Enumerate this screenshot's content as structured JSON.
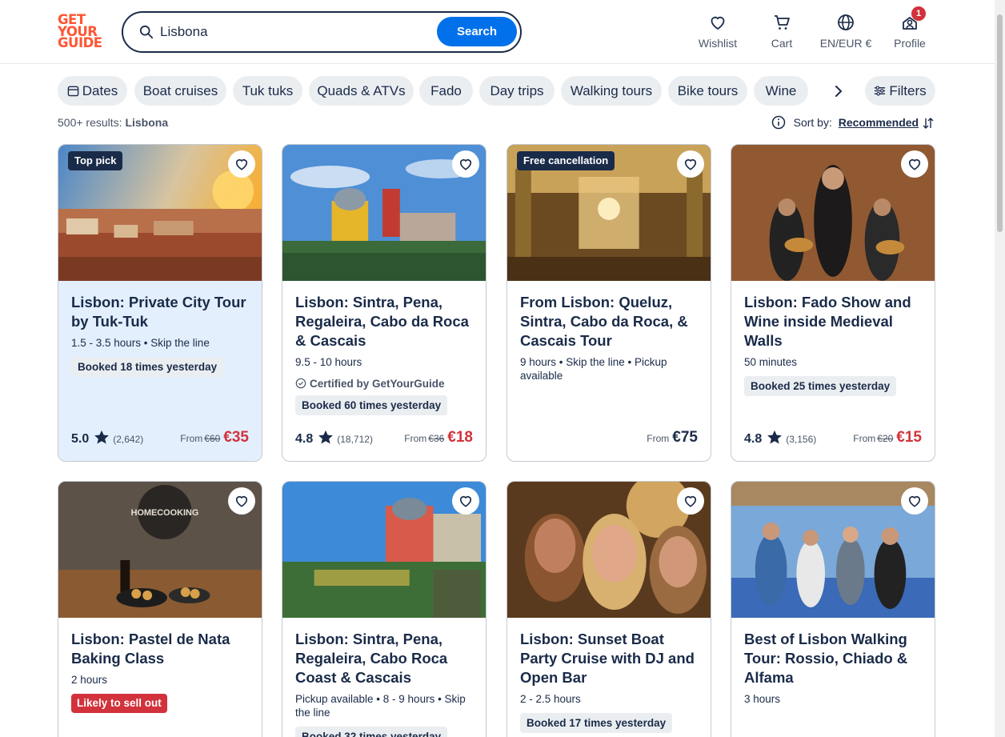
{
  "header": {
    "logo": [
      "GET",
      "YOUR",
      "GUIDE"
    ],
    "search_value": "Lisbona",
    "search_button": "Search",
    "nav": [
      {
        "label": "Wishlist",
        "icon": "heart-icon"
      },
      {
        "label": "Cart",
        "icon": "cart-icon"
      },
      {
        "label": "EN/EUR €",
        "icon": "globe-icon"
      },
      {
        "label": "Profile",
        "icon": "profile-icon",
        "badge": "1"
      }
    ]
  },
  "filters": {
    "chips": [
      "Dates",
      "Boat cruises",
      "Tuk tuks",
      "Quads & ATVs",
      "Fado",
      "Day trips",
      "Walking tours",
      "Bike tours",
      "Wine"
    ],
    "filters_label": "Filters"
  },
  "results": {
    "count": "500+ results:",
    "query": "Lisbona",
    "sort_label": "Sort by:",
    "sort_value": "Recommended"
  },
  "cards": [
    {
      "tag": "Top pick",
      "title": "Lisbon: Private City Tour by Tuk-Tuk",
      "meta": "1.5 - 3.5 hours • Skip the line",
      "booked": "Booked 18 times yesterday",
      "rating": "5.0",
      "reviews": "(2,642)",
      "from": "From",
      "old_price": "€60",
      "price": "€35"
    },
    {
      "title": "Lisbon: Sintra, Pena, Regaleira, Cabo da Roca & Cascais",
      "meta": "9.5 - 10 hours",
      "certified": "Certified by GetYourGuide",
      "booked": "Booked 60 times yesterday",
      "rating": "4.8",
      "reviews": "(18,712)",
      "from": "From",
      "old_price": "€36",
      "price": "€18"
    },
    {
      "tag": "Free cancellation",
      "title": "From Lisbon: Queluz, Sintra, Cabo da Roca, & Cascais Tour",
      "meta": "9 hours • Skip the line • Pickup available",
      "from": "From",
      "price": "€75"
    },
    {
      "title": "Lisbon: Fado Show and Wine inside Medieval Walls",
      "meta": "50 minutes",
      "booked": "Booked 25 times yesterday",
      "rating": "4.8",
      "reviews": "(3,156)",
      "from": "From",
      "old_price": "€20",
      "price": "€15"
    },
    {
      "title": "Lisbon: Pastel de Nata Baking Class",
      "meta": "2 hours",
      "sell": "Likely to sell out",
      "image_text": "HOMECOOKING"
    },
    {
      "title": "Lisbon: Sintra, Pena, Regaleira, Cabo Roca Coast & Cascais",
      "meta": "Pickup available • 8 - 9 hours • Skip the line",
      "booked": "Booked 32 times yesterday"
    },
    {
      "title": "Lisbon: Sunset Boat Party Cruise with DJ and Open Bar",
      "meta": "2 - 2.5 hours",
      "booked": "Booked 17 times yesterday"
    },
    {
      "title": "Best of Lisbon Walking Tour: Rossio, Chiado & Alfama",
      "meta": "3 hours"
    }
  ],
  "colors": {
    "brand": "#ff5533",
    "primary": "#0071eb",
    "ink": "#1a2b49",
    "sale": "#d1323b",
    "highlight": "#e3effd"
  }
}
